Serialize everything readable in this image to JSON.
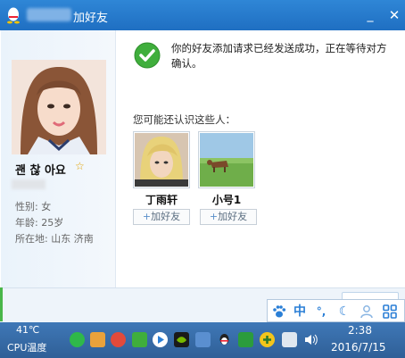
{
  "window": {
    "title": "加好友"
  },
  "profile": {
    "name": "괜 찮 아요",
    "gender": "性别: 女",
    "age": "年龄: 25岁",
    "location": "所在地: 山东  济南"
  },
  "status": {
    "message": "你的好友添加请求已经发送成功，正在等待对方确认。"
  },
  "suggestions": {
    "heading": "您可能还认识这些人：",
    "people": [
      {
        "name": "丁雨轩",
        "add_label": "加好友"
      },
      {
        "name": "小号1",
        "add_label": "加好友"
      }
    ]
  },
  "ime": {
    "mode": "中",
    "punct": "°,"
  },
  "taskbar": {
    "cpu_temp": "41℃",
    "cpu_label": "CPU温度",
    "time": "2:38",
    "date": "2016/7/15"
  },
  "colors": {
    "titlebar": "#2a7fd0",
    "taskbar": "#3a6fad",
    "success_green": "#3fae3c",
    "accent_blue": "#2b7fd6"
  },
  "icons": {
    "tray": [
      "wechat-icon",
      "users-icon",
      "weibo-icon",
      "check-green-icon",
      "media-play-icon",
      "nvidia-icon",
      "network-grid-icon",
      "qq-penguin-icon",
      "shield-icon",
      "plus-yellow-icon",
      "display-icon",
      "volume-icon"
    ]
  }
}
